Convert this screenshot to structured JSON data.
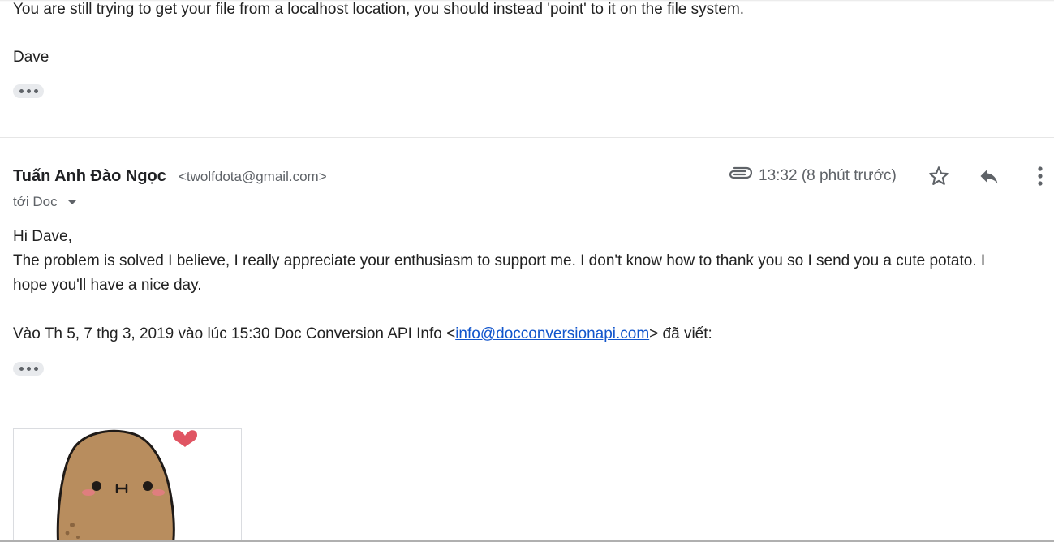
{
  "previous_message": {
    "body_line": "You are still trying to get your file from a localhost location, you should instead 'point' to it on the file system.",
    "signature": "Dave"
  },
  "message": {
    "sender_name": "Tuấn Anh Đào Ngọc",
    "sender_email": "<twolfdota@gmail.com>",
    "recipient": "tới Doc",
    "timestamp": "13:32 (8 phút trước)",
    "greeting": "Hi Dave,",
    "body_line_1": "The problem is solved I believe, I really appreciate your enthusiasm to support me. I don't know how to thank you so I send you a cute potato. I",
    "body_line_2": "hope you'll have a nice day.",
    "quote_prefix": "Vào Th 5, 7 thg 3, 2019 vào lúc 15:30 Doc Conversion API Info <",
    "quote_link": "info@docconversionapi.com",
    "quote_suffix": "> đã viết:"
  },
  "icons": {
    "attachment": "paperclip-icon",
    "star": "star-icon",
    "reply": "reply-icon",
    "more": "more-vert-icon",
    "expand": "ellipsis-icon",
    "recipient_dropdown": "caret-down-icon"
  },
  "colors": {
    "link": "#1155cc",
    "secondary_text": "#5f6368",
    "pill_bg": "#e8eaed",
    "heart": "#e05563",
    "potato_body": "#b88d5e"
  }
}
